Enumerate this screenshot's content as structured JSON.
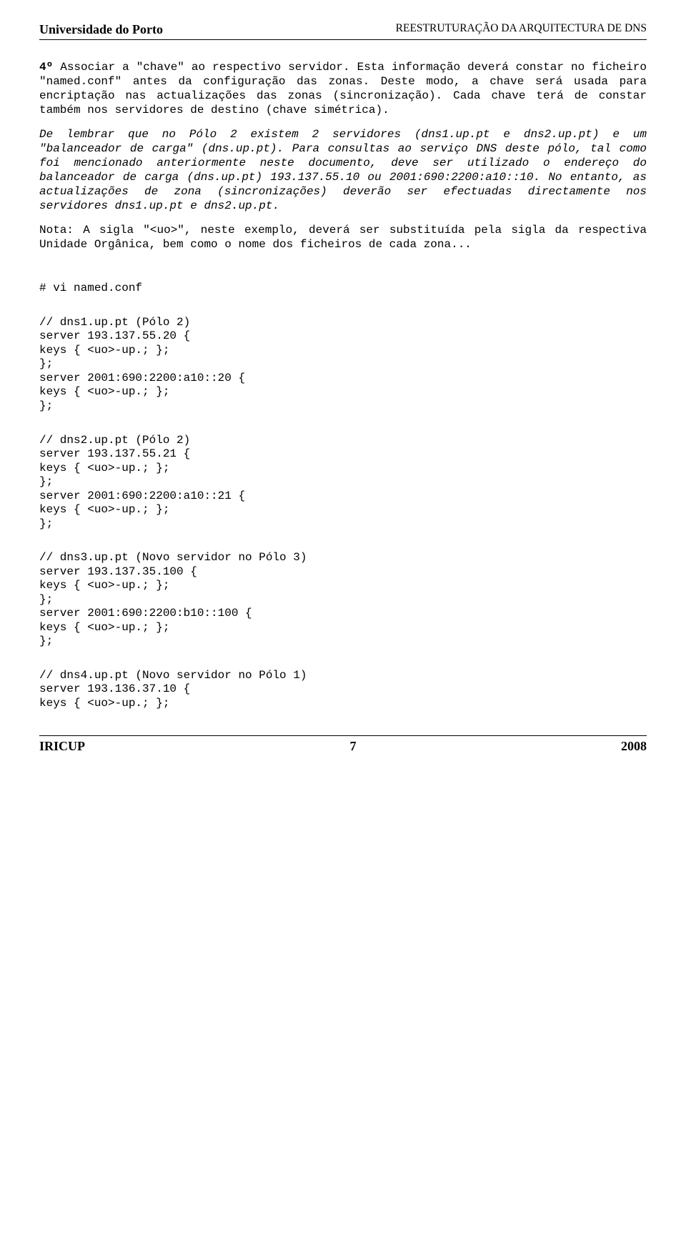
{
  "header": {
    "left": "Universidade do Porto",
    "right": "REESTRUTURAÇÃO DA ARQUITECTURA DE DNS"
  },
  "paragraphs": {
    "p1_prefix": "4º",
    "p1_body": " Associar a \"chave\" ao respectivo servidor. Esta informação deverá constar no ficheiro \"named.conf\" antes da configuração das zonas. Deste modo, a chave será usada para encriptação nas actualizações das zonas (sincronização). Cada chave terá de constar também nos servidores de destino (chave simétrica).",
    "p2": "De lembrar que no Pólo 2 existem 2 servidores (dns1.up.pt e dns2.up.pt) e um \"balanceador de carga\" (dns.up.pt). Para consultas ao serviço DNS deste pólo, tal como foi mencionado anteriormente neste documento, deve ser utilizado o endereço do balanceador de carga (dns.up.pt) 193.137.55.10 ou 2001:690:2200:a10::10. No entanto, as actualizações de zona (sincronizações) deverão ser efectuadas directamente nos servidores dns1.up.pt e dns2.up.pt.",
    "p3": "Nota: A sigla \"<uo>\", neste exemplo, deverá ser substituída pela sigla da respectiva Unidade Orgânica, bem como o nome dos ficheiros de cada zona..."
  },
  "code": {
    "cmd": "# vi named.conf",
    "s1_comment": "// dns1.up.pt (Pólo 2)",
    "s1_l1": "server 193.137.55.20 {",
    "keys_line": "keys { <uo>-up.; };",
    "close": "};",
    "s1_l2": "server 2001:690:2200:a10::20 {",
    "s2_comment": "// dns2.up.pt (Pólo 2)",
    "s2_l1": "server 193.137.55.21 {",
    "s2_l2": "server 2001:690:2200:a10::21 {",
    "s3_comment": "// dns3.up.pt (Novo servidor no Pólo 3)",
    "s3_l1": "server 193.137.35.100 {",
    "s3_l2": "server 2001:690:2200:b10::100 {",
    "s4_comment": "// dns4.up.pt (Novo servidor no Pólo 1)",
    "s4_l1": "server 193.136.37.10 {"
  },
  "footer": {
    "left": "IRICUP",
    "center": "7",
    "right": "2008"
  }
}
